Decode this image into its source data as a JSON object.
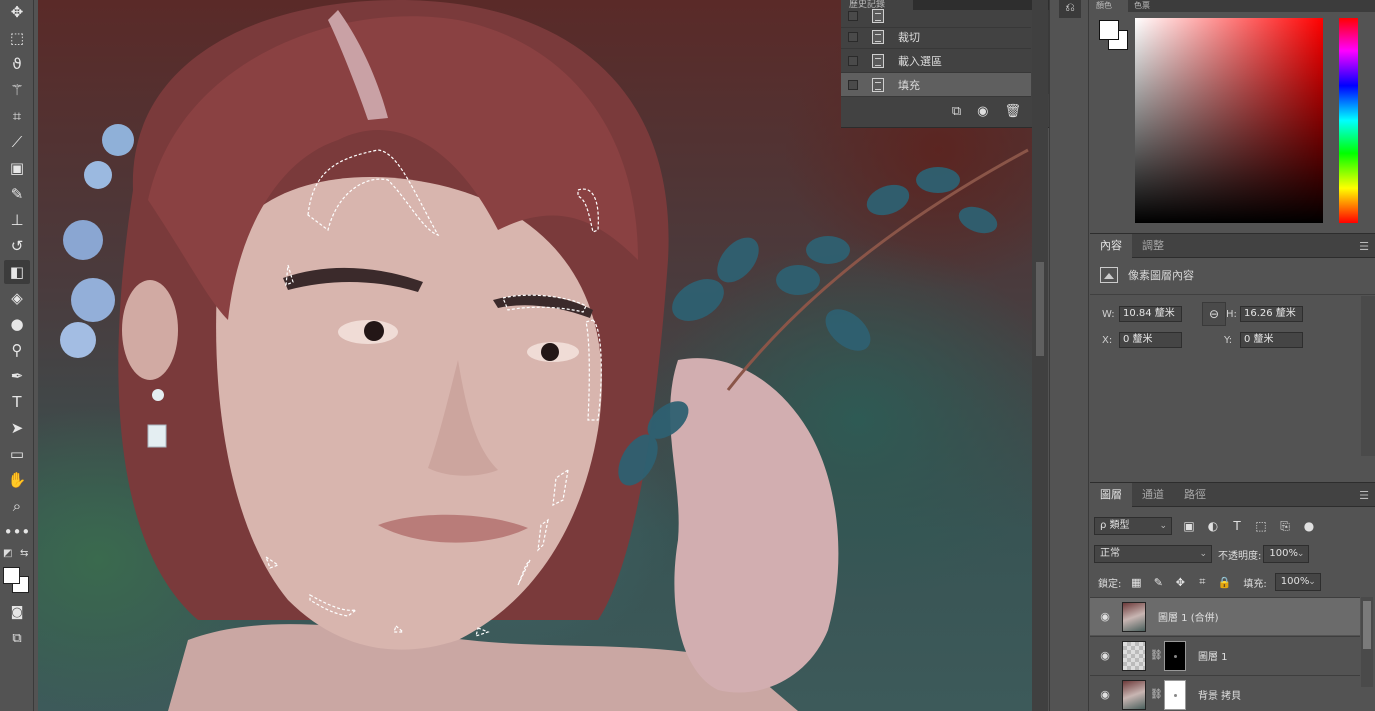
{
  "toolbar": {
    "tools": [
      "move-icon",
      "marquee-icon",
      "lasso-icon",
      "magic-wand-icon",
      "crop-icon",
      "eyedropper-icon",
      "healing-icon",
      "brush-icon",
      "stamp-icon",
      "history-brush-icon",
      "eraser-icon",
      "paint-bucket-icon",
      "blur-icon",
      "dodge-icon",
      "pen-icon",
      "type-icon",
      "path-select-icon",
      "rectangle-icon",
      "hand-icon",
      "zoom-icon",
      "more-icon"
    ],
    "active_tool": "eraser-icon",
    "type_tool_glyph": "T"
  },
  "history": {
    "tab_label": "歷史記錄",
    "items": [
      {
        "label": "",
        "selected": false
      },
      {
        "label": "裁切",
        "selected": false
      },
      {
        "label": "載入選區",
        "selected": false
      },
      {
        "label": "填充",
        "selected": true
      }
    ]
  },
  "color": {
    "tabs": [
      "顏色",
      "色票"
    ],
    "foreground": "#ffffff",
    "background": "#ffffff"
  },
  "properties": {
    "tabs": [
      "內容",
      "調整"
    ],
    "subtitle": "像素圖層內容",
    "w_label": "W:",
    "w_value": "10.84 釐米",
    "h_label": "H:",
    "h_value": "16.26 釐米",
    "x_label": "X:",
    "x_value": "0 釐米",
    "y_label": "Y:",
    "y_value": "0 釐米"
  },
  "layers": {
    "tabs": [
      "圖層",
      "通道",
      "路徑"
    ],
    "kind_filter": "ρ 類型",
    "blend_mode": "正常",
    "opacity_label": "不透明度:",
    "opacity_value": "100%",
    "lock_label": "鎖定:",
    "fill_label": "填充:",
    "fill_value": "100%",
    "items": [
      {
        "name": "圖層 1 (合併)",
        "selected": true,
        "thumb": "photo",
        "mask": null
      },
      {
        "name": "圖層 1",
        "selected": false,
        "thumb": "checker",
        "mask": "black"
      },
      {
        "name": "背景 拷貝",
        "selected": false,
        "thumb": "photo",
        "mask": "white"
      }
    ]
  }
}
